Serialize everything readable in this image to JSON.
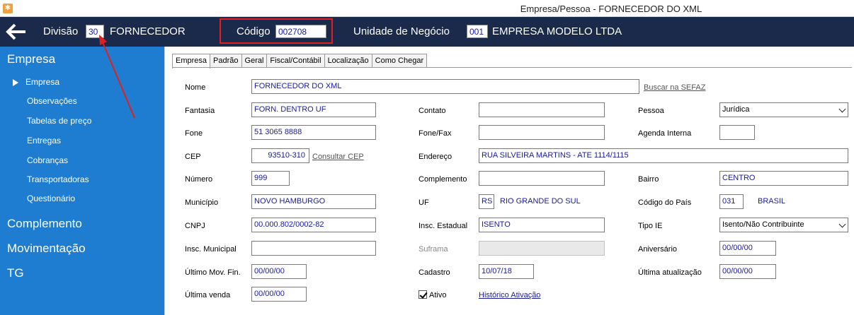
{
  "window": {
    "title": "Empresa/Pessoa - FORNECEDOR DO XML",
    "app_icon": "app-icon"
  },
  "header": {
    "divisao_label": "Divisão",
    "divisao_value": "30",
    "divisao_name": "FORNECEDOR",
    "codigo_label": "Código",
    "codigo_value": "002708",
    "unidade_label": "Unidade de Negócio",
    "unidade_value": "001",
    "unidade_name": "EMPRESA MODELO LTDA"
  },
  "sidebar": {
    "sections": [
      "Empresa",
      "Complemento",
      "Movimentação",
      "TG"
    ],
    "items": [
      "Empresa",
      "Observações",
      "Tabelas de preço",
      "Entregas",
      "Cobranças",
      "Transportadoras",
      "Questionário"
    ],
    "active_item": "Empresa"
  },
  "tabs": [
    "Empresa",
    "Padrão",
    "Geral",
    "Fiscal/Contábil",
    "Localização",
    "Como Chegar"
  ],
  "form": {
    "nome": {
      "label": "Nome",
      "value": "FORNECEDOR DO XML"
    },
    "buscar_sefaz": "Buscar na SEFAZ",
    "fantasia": {
      "label": "Fantasia",
      "value": "FORN. DENTRO UF"
    },
    "contato": {
      "label": "Contato",
      "value": ""
    },
    "pessoa": {
      "label": "Pessoa",
      "value": "Jurídica"
    },
    "fone": {
      "label": "Fone",
      "value": "51 3065 8888"
    },
    "fone_fax": {
      "label": "Fone/Fax",
      "value": ""
    },
    "agenda_interna": {
      "label": "Agenda Interna",
      "value": ""
    },
    "cep": {
      "label": "CEP",
      "value": "93510-310"
    },
    "consultar_cep": "Consultar CEP",
    "endereco": {
      "label": "Endereço",
      "value": "RUA SILVEIRA MARTINS - ATE 1114/1115"
    },
    "numero": {
      "label": "Número",
      "value": "999"
    },
    "complemento": {
      "label": "Complemento",
      "value": ""
    },
    "bairro": {
      "label": "Bairro",
      "value": "CENTRO"
    },
    "municipio": {
      "label": "Município",
      "value": "NOVO HAMBURGO"
    },
    "uf": {
      "label": "UF",
      "value": "RS",
      "name": "RIO GRANDE DO SUL"
    },
    "codigo_pais": {
      "label": "Código do País",
      "value": "031",
      "name": "BRASIL"
    },
    "cnpj": {
      "label": "CNPJ",
      "value": "00.000.802/0002-82"
    },
    "insc_estadual": {
      "label": "Insc. Estadual",
      "value": "ISENTO"
    },
    "tipo_ie": {
      "label": "Tipo IE",
      "value": "Isento/Não Contribuinte"
    },
    "insc_municipal": {
      "label": "Insc. Municipal",
      "value": ""
    },
    "suframa": {
      "label": "Suframa",
      "value": ""
    },
    "aniversario": {
      "label": "Aniversário",
      "value": "00/00/00"
    },
    "ultimo_mov_fin": {
      "label": "Último Mov. Fin.",
      "value": "00/00/00"
    },
    "cadastro": {
      "label": "Cadastro",
      "value": "10/07/18"
    },
    "ultima_atualizacao": {
      "label": "Última atualização",
      "value": "00/00/00"
    },
    "ultima_venda": {
      "label": "Última venda",
      "value": "00/00/00"
    },
    "ativo": {
      "label": "Ativo",
      "checked": true
    },
    "historico_ativacao": "Histórico Ativação"
  },
  "colors": {
    "topbar": "#1b2a4a",
    "sidebar": "#1e7dd0",
    "highlight": "#e02020",
    "value_text": "#1a1aa0"
  }
}
